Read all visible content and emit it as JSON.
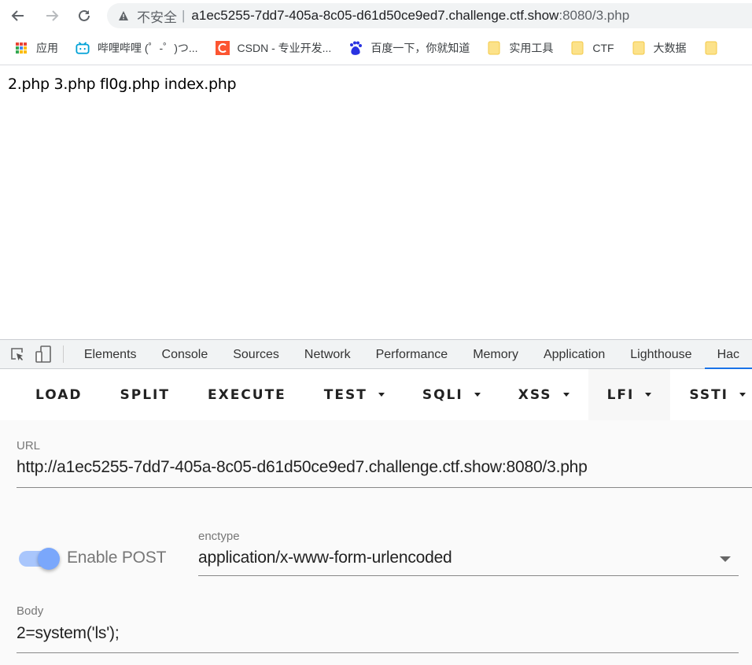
{
  "browser": {
    "security_label": "不安全",
    "separator": "|",
    "url_host": "a1ec5255-7dd7-405a-8c05-d61d50ce9ed7.challenge.ctf.show",
    "url_rest": ":8080/3.php",
    "icons": {
      "back": "arrow-left-icon",
      "forward": "arrow-right-icon",
      "reload": "reload-icon",
      "warning": "warning-triangle-icon"
    }
  },
  "bookmarks": [
    {
      "label": "应用",
      "icon": "apps-grid-icon"
    },
    {
      "label": "哔哩哔哩 (゜-゜)つ...",
      "icon": "bilibili-icon"
    },
    {
      "label": "CSDN - 专业开发...",
      "icon": "csdn-icon"
    },
    {
      "label": "百度一下，你就知道",
      "icon": "baidu-paw-icon"
    },
    {
      "label": "实用工具",
      "icon": "folder-icon"
    },
    {
      "label": "CTF",
      "icon": "folder-icon"
    },
    {
      "label": "大数据",
      "icon": "folder-icon"
    },
    {
      "label": "",
      "icon": "folder-icon"
    }
  ],
  "page": {
    "output": "2.php 3.php fl0g.php index.php"
  },
  "devtools": {
    "tabs": [
      "Elements",
      "Console",
      "Sources",
      "Network",
      "Performance",
      "Memory",
      "Application",
      "Lighthouse",
      "Hac"
    ],
    "active_tab": "Hac"
  },
  "hackbar": {
    "buttons": [
      {
        "label": "LOAD",
        "dropdown": false
      },
      {
        "label": "SPLIT",
        "dropdown": false
      },
      {
        "label": "EXECUTE",
        "dropdown": false
      },
      {
        "label": "TEST",
        "dropdown": true
      },
      {
        "label": "SQLI",
        "dropdown": true
      },
      {
        "label": "XSS",
        "dropdown": true
      },
      {
        "label": "LFI",
        "dropdown": true,
        "highlighted": true
      },
      {
        "label": "SSTI",
        "dropdown": true
      }
    ],
    "url_label": "URL",
    "url_value": "http://a1ec5255-7dd7-405a-8c05-d61d50ce9ed7.challenge.ctf.show:8080/3.php",
    "enable_post_label": "Enable POST",
    "enable_post": true,
    "enctype_label": "enctype",
    "enctype_value": "application/x-www-form-urlencoded",
    "body_label": "Body",
    "body_value": "2=system('ls');",
    "accent_color": "#7aa7fb"
  }
}
